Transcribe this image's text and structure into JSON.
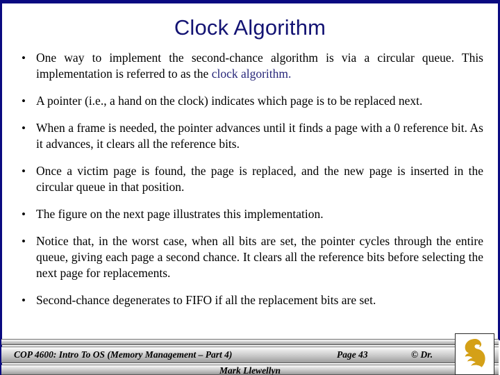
{
  "slide": {
    "title": "Clock Algorithm",
    "title_color": "#131373",
    "frame_color": "#0a0a80",
    "highlight_color": "#262679",
    "background_color": "#ffffff",
    "bullet_marker": "•",
    "bullets": [
      {
        "id": "bullet-1",
        "text_before": "One way to implement the second-chance algorithm is via a circular queue.  This implementation is referred to as the ",
        "highlight": "clock algorithm.",
        "text_after": ""
      },
      {
        "id": "bullet-2",
        "text_before": "A pointer (i.e., a hand on the clock) indicates which page is to be replaced next.",
        "highlight": "",
        "text_after": ""
      },
      {
        "id": "bullet-3",
        "text_before": "When a frame is needed, the pointer advances until it finds a page with a 0 reference bit.  As it advances, it clears all the reference bits.",
        "highlight": "",
        "text_after": ""
      },
      {
        "id": "bullet-4",
        "text_before": "Once a victim page is found, the page is replaced, and the new page is inserted in the circular queue in that position.",
        "highlight": "",
        "text_after": ""
      },
      {
        "id": "bullet-5",
        "text_before": "The figure on the next page illustrates this implementation.",
        "highlight": "",
        "text_after": ""
      },
      {
        "id": "bullet-6",
        "text_before": "Notice that, in the worst case, when all bits are set, the pointer cycles through the entire queue, giving each page a second chance.  It clears all the reference bits before selecting the next page for replacements.",
        "highlight": "",
        "text_after": ""
      },
      {
        "id": "bullet-7",
        "text_before": "Second-chance degenerates to FIFO if all the replacement bits are set.",
        "highlight": "",
        "text_after": ""
      }
    ]
  },
  "footer": {
    "course": "COP 4600: Intro To OS  (Memory Management – Part 4)",
    "page": "Page 43",
    "copyright": "© Dr.",
    "author": "Mark Llewellyn",
    "logo_name": "ucf-pegasus-logo",
    "logo_color": "#d4a017"
  }
}
